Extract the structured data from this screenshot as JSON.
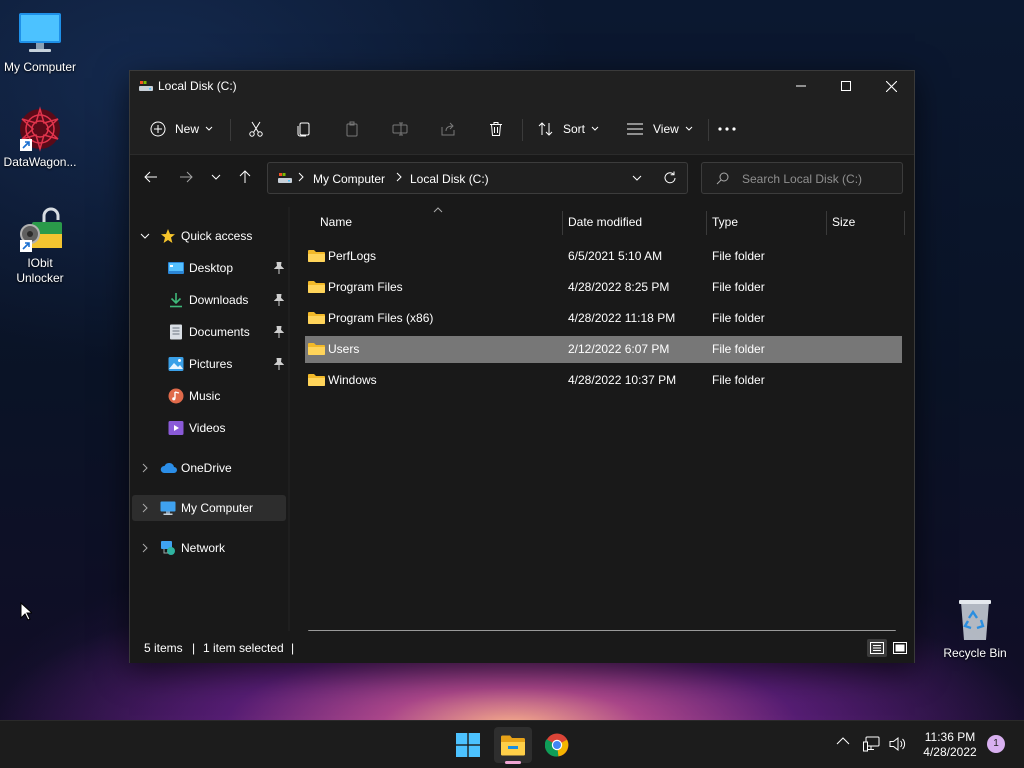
{
  "desktop": {
    "icons": [
      {
        "label": "My Computer"
      },
      {
        "label": "DataWagon..."
      },
      {
        "label": "IObit\nUnlocker"
      },
      {
        "label": "Recycle Bin"
      }
    ]
  },
  "window": {
    "title": "Local Disk (C:)",
    "toolbar": {
      "new_label": "New",
      "sort_label": "Sort",
      "view_label": "View"
    },
    "address": {
      "crumbs": [
        "My Computer",
        "Local Disk (C:)"
      ]
    },
    "search": {
      "placeholder": "Search Local Disk (C:)"
    },
    "sidebar": {
      "quick_access": "Quick access",
      "items": [
        {
          "label": "Desktop",
          "pinned": true
        },
        {
          "label": "Downloads",
          "pinned": true
        },
        {
          "label": "Documents",
          "pinned": true
        },
        {
          "label": "Pictures",
          "pinned": true
        },
        {
          "label": "Music",
          "pinned": false
        },
        {
          "label": "Videos",
          "pinned": false
        }
      ],
      "onedrive": "OneDrive",
      "my_computer": "My Computer",
      "network": "Network"
    },
    "columns": {
      "name": "Name",
      "date": "Date modified",
      "type": "Type",
      "size": "Size"
    },
    "files": [
      {
        "name": "PerfLogs",
        "date": "6/5/2021 5:10 AM",
        "type": "File folder",
        "size": ""
      },
      {
        "name": "Program Files",
        "date": "4/28/2022 8:25 PM",
        "type": "File folder",
        "size": ""
      },
      {
        "name": "Program Files (x86)",
        "date": "4/28/2022 11:18 PM",
        "type": "File folder",
        "size": ""
      },
      {
        "name": "Users",
        "date": "2/12/2022 6:07 PM",
        "type": "File folder",
        "size": "",
        "selected": true
      },
      {
        "name": "Windows",
        "date": "4/28/2022 10:37 PM",
        "type": "File folder",
        "size": ""
      }
    ],
    "status": {
      "items": "5 items",
      "selected": "1 item selected"
    }
  },
  "taskbar": {
    "time": "11:36 PM",
    "date": "4/28/2022",
    "notifications": "1"
  },
  "colors": {
    "window_bg": "#191919",
    "toolbar_bg": "#202020",
    "selection": "#777777",
    "accent": "#4cc2ff"
  }
}
